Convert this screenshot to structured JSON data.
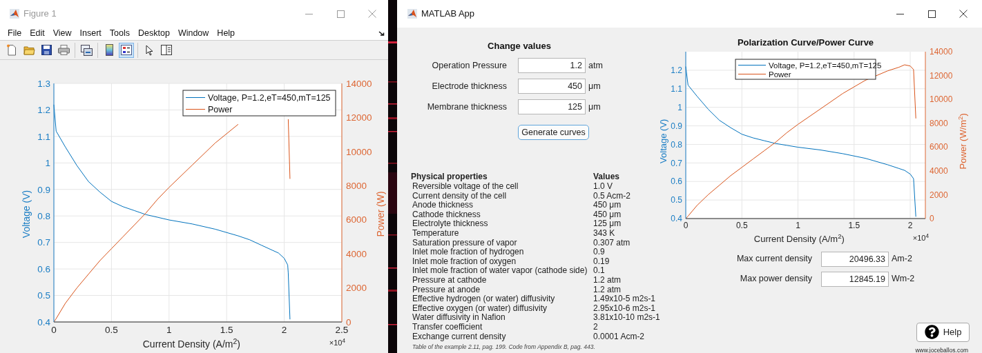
{
  "figure_window": {
    "title": "Figure 1",
    "menu": [
      "File",
      "Edit",
      "View",
      "Insert",
      "Tools",
      "Desktop",
      "Window",
      "Help"
    ],
    "toolbar": [
      {
        "selected": false
      },
      {
        "selected": false
      },
      {
        "selected": false
      },
      {
        "selected": false
      },
      {
        "selected": false
      },
      {
        "selected": false
      },
      {
        "selected": true
      },
      {
        "selected": false
      },
      {
        "selected": false
      }
    ],
    "chart_multiplier": "×10$^{4}$",
    "chart_data": {
      "type": "line",
      "xlabel": "Current Density (A/m$^{2}$)",
      "ylabel": "Voltage (V)",
      "y2label": "Power (W)",
      "grid": true,
      "legend": true,
      "x": [
        0,
        0.02,
        0.1,
        0.2,
        0.3,
        0.4,
        0.5,
        0.6,
        0.7,
        0.8,
        0.9,
        1,
        1.2,
        1.4,
        1.6,
        1.7,
        1.8,
        1.9,
        1.95,
        2,
        2.03,
        2.035,
        2.05
      ],
      "xlim": [
        0,
        2.5
      ],
      "ylim": [
        0.4,
        1.3
      ],
      "y2lim": [
        0,
        14000
      ],
      "xticks": [
        0,
        0.5,
        1,
        1.5,
        2,
        2.5
      ],
      "yticks": [
        0.4,
        0.5,
        0.6,
        0.7,
        0.8,
        0.9,
        1,
        1.1,
        1.2,
        1.3
      ],
      "y2ticks": [
        0,
        2000,
        4000,
        6000,
        8000,
        10000,
        12000,
        14000
      ],
      "series": [
        {
          "name": "Voltage, P=1.2,eT=450,mT=125",
          "color": "#0072bd",
          "values": [
            1.22,
            1.12,
            1.06,
            0.99,
            0.93,
            0.89,
            0.855,
            0.835,
            0.82,
            0.805,
            0.795,
            0.785,
            0.77,
            0.75,
            0.725,
            0.71,
            0.69,
            0.67,
            0.66,
            0.64,
            0.615,
            0.585,
            0.41
          ]
        },
        {
          "name": "Power",
          "color": "#d95319",
          "axis": "y2",
          "values": [
            0,
            200,
            1100,
            2000,
            2800,
            3600,
            4300,
            5000,
            5700,
            6400,
            7200,
            7900,
            9200,
            10500,
            11600,
            null,
            null,
            null,
            null,
            null,
            null,
            11900,
            8400
          ]
        }
      ]
    }
  },
  "app_window": {
    "title": "MATLAB App",
    "inputs_title": "Change values",
    "inputs": [
      {
        "label": "Operation Pressure",
        "value": "1.2",
        "unit": "atm"
      },
      {
        "label": "Electrode thickness",
        "value": "450",
        "unit": "μm"
      },
      {
        "label": "Membrane thickness",
        "value": "125",
        "unit": "μm"
      }
    ],
    "generate_button": "Generate curves",
    "properties": {
      "columns": [
        "Physical properties",
        "Values"
      ],
      "rows": [
        {
          "name": "Reversible voltage of the cell",
          "value": "1.0 V"
        },
        {
          "name": "Current density of the cell",
          "value": "0.5 Acm-2"
        },
        {
          "name": "Anode thickness",
          "value": "450 μm"
        },
        {
          "name": "Cathode thickness",
          "value": "450 μm"
        },
        {
          "name": "Electrolyte thickness",
          "value": "125 μm"
        },
        {
          "name": "Temperature",
          "value": "343 K"
        },
        {
          "name": "Saturation pressure of vapor",
          "value": "0.307 atm"
        },
        {
          "name": "Inlet mole fraction of hydrogen",
          "value": "0.9"
        },
        {
          "name": "Inlet mole fraction of oxygen",
          "value": "0.19"
        },
        {
          "name": "Inlet mole fraction of water vapor (cathode side)",
          "value": "0.1"
        },
        {
          "name": "Pressure at cathode",
          "value": "1.2 atm"
        },
        {
          "name": "Pressure at anode",
          "value": "1.2 atm"
        },
        {
          "name": "Effective hydrogen (or water) diffusivity",
          "value": "1.49x10-5 m2s-1"
        },
        {
          "name": "Effective oxygen (or water) diffusivity",
          "value": "2.95x10-6 m2s-1"
        },
        {
          "name": "Water diffusivity in Nafion",
          "value": "3.81x10-10 m2s-1"
        },
        {
          "name": "Transfer coefficient",
          "value": "2"
        },
        {
          "name": "Exchange current density",
          "value": "0.0001 Acm-2"
        }
      ],
      "note": "Table of the example 2.11, pag. 199. Code from Appendix B, pag. 443."
    },
    "chart_multiplier": "×10$^{4}$",
    "chart_data": {
      "type": "line",
      "title": "Polarization Curve/Power Curve",
      "xlabel": "Current Density (A/m$^{2}$)",
      "ylabel": "Voltage (V)",
      "y2label": "Power (W/m$^{2}$)",
      "grid": true,
      "legend": true,
      "x": [
        0,
        0.02,
        0.1,
        0.2,
        0.3,
        0.4,
        0.5,
        0.6,
        0.7,
        0.8,
        0.9,
        1,
        1.2,
        1.4,
        1.6,
        1.8,
        1.9,
        1.95,
        2,
        2.03,
        2.05
      ],
      "xlim": [
        0,
        2.135
      ],
      "ylim": [
        0.4,
        1.3
      ],
      "y2lim": [
        0,
        14000
      ],
      "xticks": [
        0,
        0.5,
        1,
        1.5,
        2
      ],
      "yticks": [
        0.4,
        0.5,
        0.6,
        0.7,
        0.8,
        0.9,
        1,
        1.1,
        1.2
      ],
      "y2ticks": [
        0,
        2000,
        4000,
        6000,
        8000,
        10000,
        12000,
        14000
      ],
      "series": [
        {
          "name": "Voltage, P=1.2,eT=450,mT=125",
          "color": "#0072bd",
          "values": [
            1.22,
            1.12,
            1.06,
            0.99,
            0.93,
            0.89,
            0.855,
            0.835,
            0.82,
            0.805,
            0.795,
            0.785,
            0.77,
            0.75,
            0.725,
            0.69,
            0.67,
            0.66,
            0.64,
            0.615,
            0.41
          ]
        },
        {
          "name": "Power",
          "color": "#d95319",
          "axis": "y2",
          "values": [
            0,
            200,
            1100,
            2000,
            2800,
            3600,
            4300,
            5000,
            5700,
            6400,
            7200,
            7900,
            9200,
            10500,
            11600,
            12400,
            12700,
            12900,
            12800,
            12500,
            8400
          ]
        }
      ]
    },
    "results": [
      {
        "label": "Max current density",
        "value": "20496.33",
        "unit": "Am-2"
      },
      {
        "label": "Max power density",
        "value": "12845.19",
        "unit": "Wm-2"
      }
    ],
    "help_button": "Help",
    "website": "www.joceballos.com"
  }
}
